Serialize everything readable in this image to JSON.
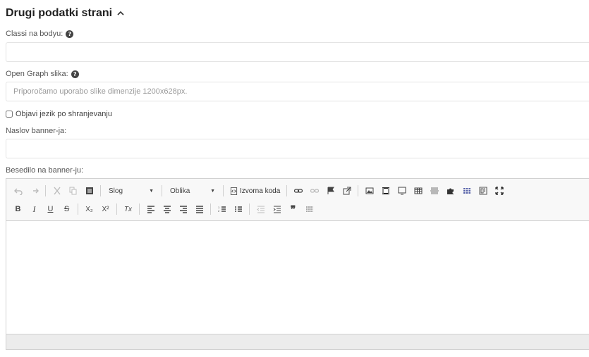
{
  "section": {
    "title": "Drugi podatki strani"
  },
  "fields": {
    "body_classes": {
      "label": "Classi na bodyu:",
      "value": "",
      "placeholder": ""
    },
    "og_image": {
      "label": "Open Graph slika:",
      "value": "",
      "placeholder": "Priporočamo uporabo slike dimenzije 1200x628px."
    },
    "publish_language": {
      "label": "Objavi jezik po shranjevanju",
      "checked": false
    },
    "banner_title": {
      "label": "Naslov banner-ja:",
      "value": "",
      "placeholder": ""
    },
    "banner_text": {
      "label": "Besedilo na banner-ju:"
    }
  },
  "editor": {
    "style_combo": "Slog",
    "format_combo": "Oblika",
    "source_label": "Izvorna koda",
    "bold_glyph": "B",
    "italic_glyph": "I",
    "underline_glyph": "U",
    "strike_glyph": "S",
    "subscript_glyph": "X₂",
    "superscript_glyph": "X²",
    "remove_format_glyph": "Tx",
    "quote_glyph": "❞",
    "help_glyph": "?"
  }
}
